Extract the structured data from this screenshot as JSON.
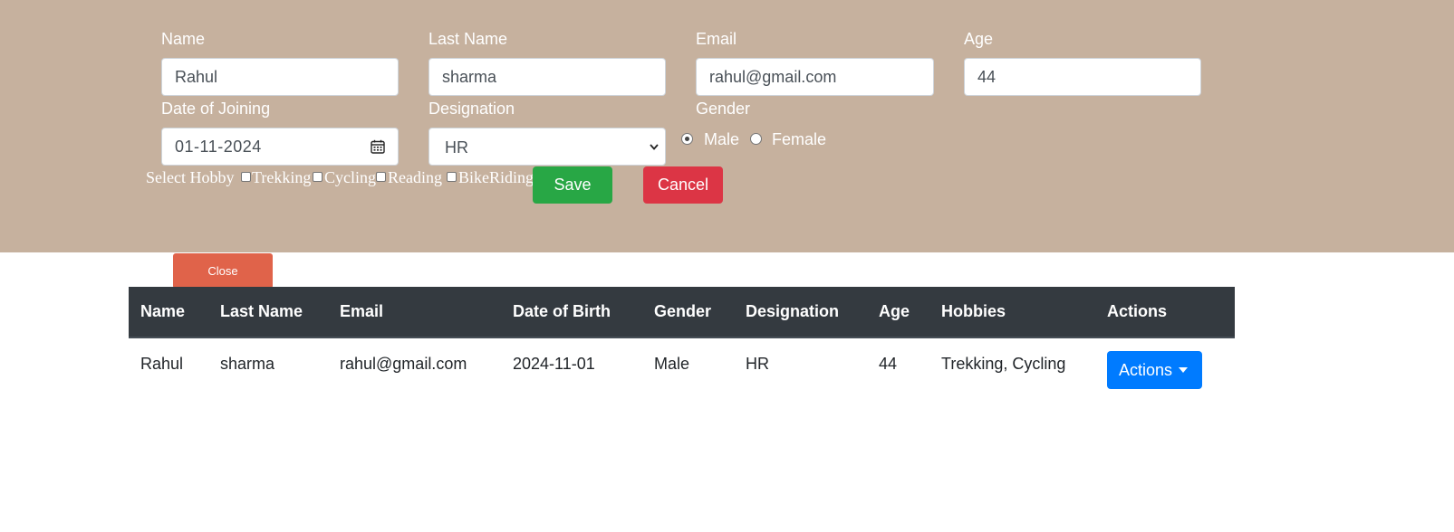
{
  "form": {
    "labels": {
      "name": "Name",
      "last_name": "Last Name",
      "email": "Email",
      "age": "Age",
      "doj": "Date of Joining",
      "designation": "Designation",
      "gender": "Gender",
      "select_hobby": "Select Hobby"
    },
    "values": {
      "name": "Rahul",
      "last_name": "sharma",
      "email": "rahul@gmail.com",
      "age": "44",
      "doj": "01-11-2024",
      "designation": "HR"
    },
    "gender_options": {
      "male": "Male",
      "female": "Female"
    },
    "gender_selected": "Male",
    "hobbies": [
      "Trekking",
      "Cycling",
      "Reading",
      "BikeRiding"
    ],
    "buttons": {
      "save": "Save",
      "cancel": "Cancel"
    },
    "colors": {
      "panel_bg": "#c6b19e",
      "save": "#28a745",
      "cancel": "#dc3545"
    }
  },
  "close_button": "Close",
  "table": {
    "headers": [
      "Name",
      "Last Name",
      "Email",
      "Date of Birth",
      "Gender",
      "Designation",
      "Age",
      "Hobbies",
      "Actions"
    ],
    "rows": [
      {
        "name": "Rahul",
        "last_name": "sharma",
        "email": "rahul@gmail.com",
        "dob": "2024-11-01",
        "gender": "Male",
        "designation": "HR",
        "age": "44",
        "hobbies": "Trekking, Cycling",
        "actions_label": "Actions"
      }
    ],
    "colors": {
      "header_bg": "#343a40",
      "actions_btn": "#007bff"
    }
  }
}
